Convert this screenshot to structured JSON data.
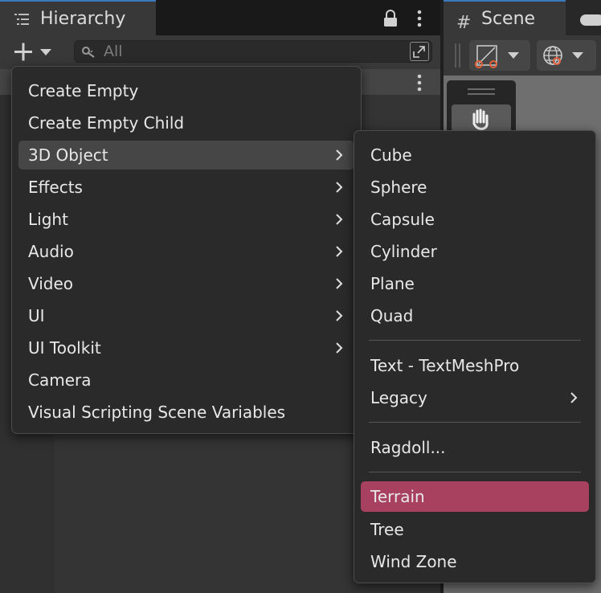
{
  "hierarchy": {
    "tab_label": "Hierarchy",
    "search_placeholder": "All"
  },
  "scene": {
    "tab_label": "Scene",
    "grid_glyph": "#"
  },
  "colors": {
    "accent_highlight": "#a8405f",
    "hover_highlight": "#464646",
    "tab_active_line": "#3a79bb"
  },
  "icons": [
    "hierarchy-icon",
    "lock-icon",
    "more-vert-icon",
    "plus-icon",
    "search-icon",
    "expand-icon",
    "grid-icon",
    "gamepad-icon",
    "shading-mode-icon",
    "globe-icon",
    "hand-icon",
    "chevron-right-icon"
  ],
  "create_menu": {
    "items": [
      {
        "label": "Create Empty",
        "submenu": false
      },
      {
        "label": "Create Empty Child",
        "submenu": false
      },
      {
        "label": "3D Object",
        "submenu": true
      },
      {
        "label": "Effects",
        "submenu": true
      },
      {
        "label": "Light",
        "submenu": true
      },
      {
        "label": "Audio",
        "submenu": true
      },
      {
        "label": "Video",
        "submenu": true
      },
      {
        "label": "UI",
        "submenu": true
      },
      {
        "label": "UI Toolkit",
        "submenu": true
      },
      {
        "label": "Camera",
        "submenu": false
      },
      {
        "label": "Visual Scripting Scene Variables",
        "submenu": false
      }
    ],
    "highlighted": "3D Object"
  },
  "object_submenu": {
    "items": [
      {
        "label": "Cube"
      },
      {
        "label": "Sphere"
      },
      {
        "label": "Capsule"
      },
      {
        "label": "Cylinder"
      },
      {
        "label": "Plane"
      },
      {
        "label": "Quad"
      },
      {
        "label": "Text - TextMeshPro"
      },
      {
        "label": "Legacy",
        "submenu": true
      },
      {
        "label": "Ragdoll..."
      },
      {
        "label": "Terrain"
      },
      {
        "label": "Tree"
      },
      {
        "label": "Wind Zone"
      }
    ],
    "selected": "Terrain"
  }
}
